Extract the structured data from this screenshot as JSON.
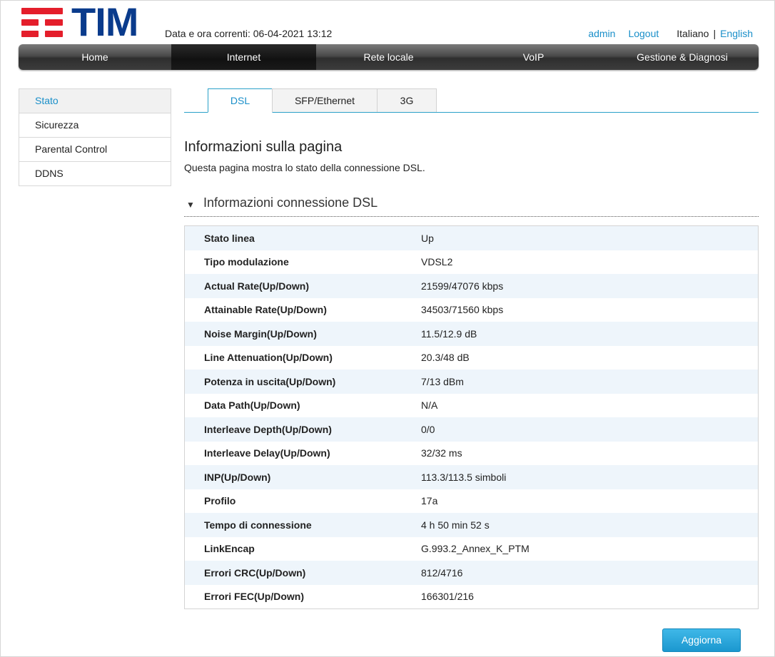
{
  "header": {
    "brand": "TIM",
    "datetime": "Data e ora correnti: 06-04-2021 13:12",
    "user": "admin",
    "logout": "Logout",
    "lang_it": "Italiano",
    "lang_sep": "|",
    "lang_en": "English"
  },
  "nav": {
    "items": [
      {
        "label": "Home"
      },
      {
        "label": "Internet"
      },
      {
        "label": "Rete locale"
      },
      {
        "label": "VoIP"
      },
      {
        "label": "Gestione & Diagnosi"
      }
    ],
    "active_index": 1
  },
  "sidebar": {
    "items": [
      {
        "label": "Stato"
      },
      {
        "label": "Sicurezza"
      },
      {
        "label": "Parental Control"
      },
      {
        "label": "DDNS"
      }
    ]
  },
  "tabs": [
    {
      "label": "DSL"
    },
    {
      "label": "SFP/Ethernet"
    },
    {
      "label": "3G"
    }
  ],
  "page": {
    "title": "Informazioni sulla pagina",
    "description": "Questa pagina mostra lo stato della connessione DSL."
  },
  "section": {
    "title": "Informazioni connessione DSL"
  },
  "rows": [
    {
      "key": "Stato linea",
      "value": "Up"
    },
    {
      "key": "Tipo modulazione",
      "value": "VDSL2"
    },
    {
      "key": "Actual Rate(Up/Down)",
      "value": "21599/47076 kbps"
    },
    {
      "key": "Attainable Rate(Up/Down)",
      "value": "34503/71560 kbps"
    },
    {
      "key": "Noise Margin(Up/Down)",
      "value": "11.5/12.9 dB"
    },
    {
      "key": "Line Attenuation(Up/Down)",
      "value": "20.3/48 dB"
    },
    {
      "key": "Potenza in uscita(Up/Down)",
      "value": "7/13 dBm"
    },
    {
      "key": "Data Path(Up/Down)",
      "value": "N/A"
    },
    {
      "key": "Interleave Depth(Up/Down)",
      "value": "0/0"
    },
    {
      "key": "Interleave Delay(Up/Down)",
      "value": "32/32 ms"
    },
    {
      "key": "INP(Up/Down)",
      "value": "113.3/113.5 simboli"
    },
    {
      "key": "Profilo",
      "value": "17a"
    },
    {
      "key": "Tempo di connessione",
      "value": "4 h 50 min 52 s"
    },
    {
      "key": "LinkEncap",
      "value": "G.993.2_Annex_K_PTM"
    },
    {
      "key": "Errori CRC(Up/Down)",
      "value": "812/4716"
    },
    {
      "key": "Errori FEC(Up/Down)",
      "value": "166301/216"
    }
  ],
  "actions": {
    "refresh": "Aggiorna"
  },
  "colors": {
    "brand_red": "#e41e2b",
    "brand_blue": "#0a3b8c",
    "link": "#1a8fc9",
    "accent": "#2aa0c8"
  }
}
